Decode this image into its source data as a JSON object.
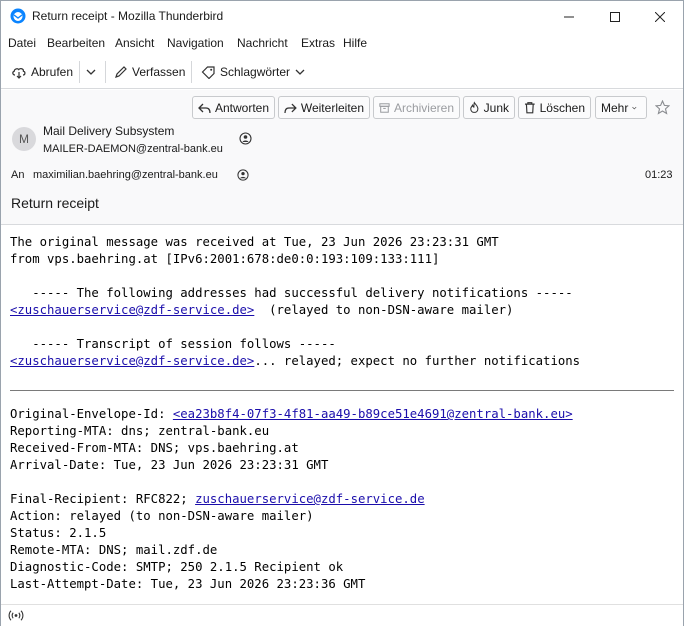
{
  "window": {
    "title": "Return receipt - Mozilla Thunderbird"
  },
  "menu": [
    "Datei",
    "Bearbeiten",
    "Ansicht",
    "Navigation",
    "Nachricht",
    "Extras",
    "Hilfe"
  ],
  "toolbar": {
    "fetch_label": "Abrufen",
    "compose_label": "Verfassen",
    "tags_label": "Schlagwörter"
  },
  "actions": {
    "reply": "Antworten",
    "forward": "Weiterleiten",
    "archive": "Archivieren",
    "junk": "Junk",
    "delete": "Löschen",
    "more": "Mehr"
  },
  "message": {
    "avatar_letter": "M",
    "from_name": "Mail Delivery Subsystem",
    "from_address": "MAILER-DAEMON@zentral-bank.eu",
    "to_label": "An",
    "to_address": "maximilian.baehring@zentral-bank.eu",
    "time": "01:23",
    "subject": "Return receipt"
  },
  "body": {
    "l1": "The original message was received at Tue, 23 Jun 2026 23:23:31 GMT",
    "l2": "from vps.baehring.at [IPv6:2001:678:de0:0:193:109:133:111]",
    "l3": "   ----- The following addresses had successful delivery notifications -----",
    "l4_link": "<zuschauerservice@zdf-service.de>",
    "l4_rest": "  (relayed to non-DSN-aware mailer)",
    "l5": "   ----- Transcript of session follows -----",
    "l6_link": "<zuschauerservice@zdf-service.de>",
    "l6_rest": "... relayed; expect no further notifications",
    "env_label": "Original-Envelope-Id: ",
    "env_link": "<ea23b8f4-07f3-4f81-aa49-b89ce51e4691@zentral-bank.eu>",
    "reporting": "Reporting-MTA: dns; zentral-bank.eu",
    "received": "Received-From-MTA: DNS; vps.baehring.at",
    "arrival": "Arrival-Date: Tue, 23 Jun 2026 23:23:31 GMT",
    "final_label": "Final-Recipient: RFC822; ",
    "final_link": "zuschauerservice@zdf-service.de",
    "action": "Action: relayed (to non-DSN-aware mailer)",
    "status": "Status: 2.1.5",
    "remote": "Remote-MTA: DNS; mail.zdf.de",
    "diag": "Diagnostic-Code: SMTP; 250 2.1.5 Recipient ok",
    "last": "Last-Attempt-Date: Tue, 23 Jun 2026 23:23:36 GMT"
  }
}
